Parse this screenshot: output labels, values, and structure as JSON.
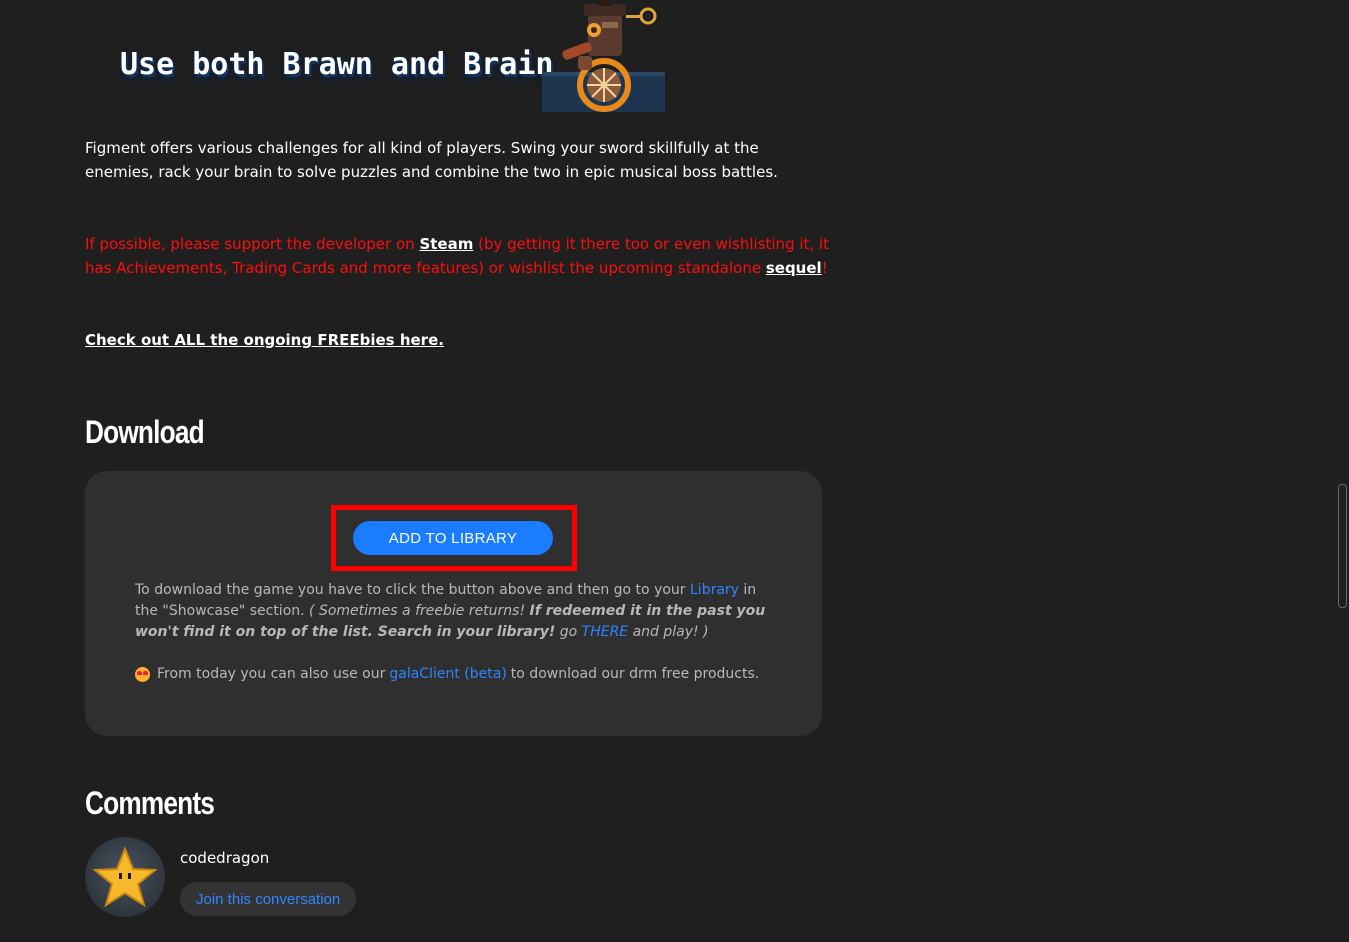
{
  "banner": {
    "text": "Use both Brawn and Brain",
    "art_icon": "clockwork-robot-character"
  },
  "description": "Figment offers various challenges for all kind of players. Swing your sword skillfully at the enemies, rack your brain to solve puzzles and combine the two in epic musical boss battles.",
  "support": {
    "part1": "If possible, please support the developer on ",
    "steam_link": "Steam",
    "part2": " (by getting it there too or even wishlisting it, it has Achievements, Trading Cards and more features) or wishlist the upcoming standalone ",
    "sequel_link": "sequel",
    "part3": "!"
  },
  "freebies_link": "Check out ALL the ongoing FREEbies here.",
  "download": {
    "title": "Download",
    "add_button": "ADD TO LIBRARY",
    "info_part1": "To download the game you have to click the button above and then go to your ",
    "library_link": "Library",
    "info_part2": " in the \"Showcase\" section. ",
    "info_italic1": "( Sometimes a freebie returns! ",
    "info_bold": "If redeemed it in the past you won't find it on top of the list. Search in your library!",
    "info_italic2": " go ",
    "there_link": "THERE",
    "info_italic3": " and play! )",
    "client_prefix": "From today you can also use our",
    "client_link": "galaClient (beta)",
    "client_suffix": "to download our drm free products.",
    "emoji_icon": "star-struck-emoji",
    "colors": {
      "button": "#1a7dff",
      "highlight": "#ff0000",
      "link": "#2e86ff"
    }
  },
  "comments": {
    "title": "Comments",
    "username": "codedragon",
    "join_button": "Join this conversation",
    "avatar_icon": "star-avatar"
  },
  "colors": {
    "background": "#1f1f1f",
    "card": "#2f2f2f",
    "warning_text": "#ff0d0d"
  }
}
